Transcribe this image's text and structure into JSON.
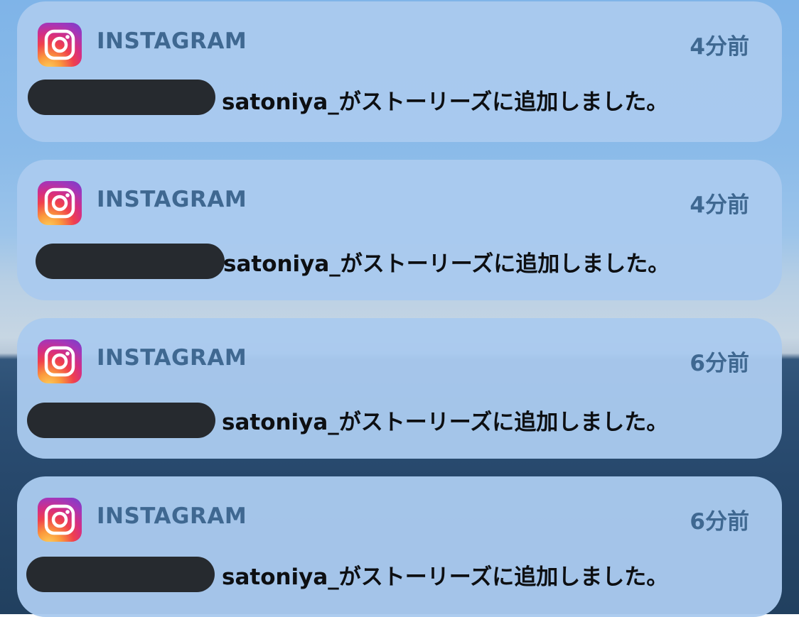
{
  "notifications": [
    {
      "app_name": "INSTAGRAM",
      "time": "4分前",
      "message": "satoniya_がストーリーズに追加しました。"
    },
    {
      "app_name": "INSTAGRAM",
      "time": "4分前",
      "message": "satoniya_がストーリーズに追加しました。"
    },
    {
      "app_name": "INSTAGRAM",
      "time": "6分前",
      "message": "satoniya_がストーリーズに追加しました。"
    },
    {
      "app_name": "INSTAGRAM",
      "time": "6分前",
      "message": "satoniya_がストーリーズに追加しました。"
    }
  ],
  "icon": "instagram-icon",
  "colors": {
    "card_bg": "#aacaee",
    "header_text": "#3f6891",
    "body_text": "#0d0f12",
    "redaction": "#262a2f"
  }
}
